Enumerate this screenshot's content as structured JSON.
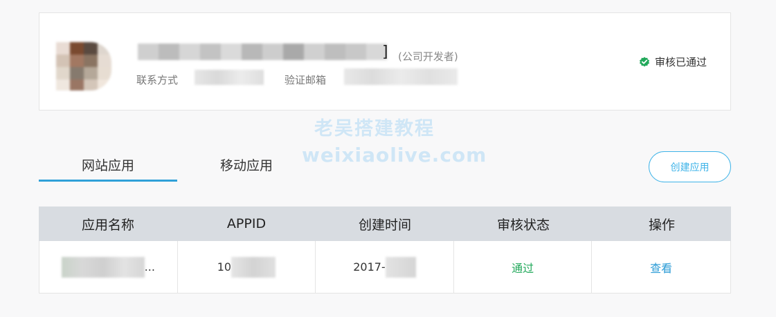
{
  "profile": {
    "developer_type": "(公司开发者)",
    "bracket": "]",
    "contact_label": "联系方式",
    "email_label": "验证邮箱",
    "status": "审核已通过",
    "status_icon": "check-badge-icon"
  },
  "watermark": {
    "line1": "老吴搭建教程",
    "line2": "weixiaolive.com"
  },
  "tabs": [
    {
      "label": "网站应用",
      "active": true
    },
    {
      "label": "移动应用",
      "active": false
    }
  ],
  "create_button": "创建应用",
  "table": {
    "headers": [
      "应用名称",
      "APPID",
      "创建时间",
      "审核状态",
      "操作"
    ],
    "rows": [
      {
        "name_suffix": "...",
        "appid_prefix": "10",
        "date_prefix": "2017-",
        "status": "通过",
        "action": "查看"
      }
    ]
  },
  "colors": {
    "accent": "#2fa0d8",
    "success": "#22a95b",
    "link": "#2a9bd6",
    "header_bg": "#d8dce1"
  }
}
